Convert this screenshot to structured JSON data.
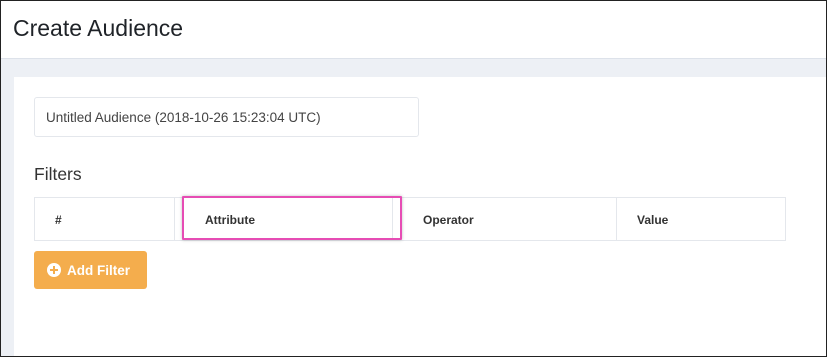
{
  "header": {
    "title": "Create Audience"
  },
  "audience": {
    "name": "Untitled Audience (2018-10-26 15:23:04 UTC)"
  },
  "filters": {
    "title": "Filters",
    "columns": [
      "#",
      "Attribute",
      "Operator",
      "Value"
    ],
    "add_button": "Add Filter",
    "add_icon": "plus-circle-icon"
  },
  "colors": {
    "accent": "#f4ad4d",
    "highlight": "#e64cb4"
  }
}
